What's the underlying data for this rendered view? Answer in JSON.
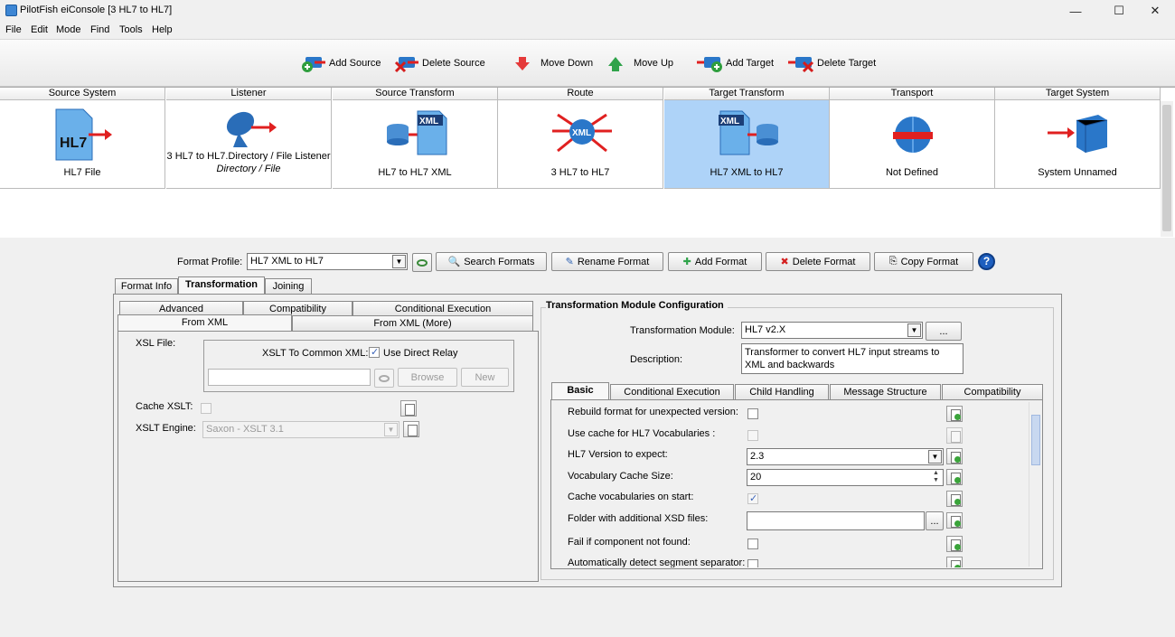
{
  "window": {
    "title": "PilotFish eiConsole [3 HL7 to HL7]"
  },
  "menu": [
    "File",
    "Edit",
    "Mode",
    "Find",
    "Tools",
    "Help"
  ],
  "toolbar": {
    "add_source": "Add Source",
    "delete_source": "Delete Source",
    "move_down": "Move Down",
    "move_up": "Move Up",
    "add_target": "Add Target",
    "delete_target": "Delete Target"
  },
  "pipeline": {
    "headers": [
      "Source System",
      "Listener",
      "Source Transform",
      "Route",
      "Target Transform",
      "Transport",
      "Target System"
    ],
    "labels": [
      "HL7 File",
      "3 HL7 to HL7.Directory / File Listener",
      "HL7 to HL7 XML",
      "3 HL7 to HL7",
      "HL7 XML to HL7",
      "Not Defined",
      "System Unnamed"
    ],
    "listener_sub": "Directory / File",
    "selected": "Target Transform"
  },
  "format": {
    "profile_label": "Format Profile:",
    "profile_value": "HL7 XML to HL7",
    "search": "Search Formats",
    "rename": "Rename Format",
    "add": "Add Format",
    "delete": "Delete Format",
    "copy": "Copy Format"
  },
  "outer_tabs": [
    "Format Info",
    "Transformation",
    "Joining"
  ],
  "inner_tabs_row1": [
    "Advanced",
    "Compatibility",
    "Conditional Execution"
  ],
  "inner_tabs_row2": [
    "From XML",
    "From XML (More)"
  ],
  "from_xml": {
    "xsl_file_label": "XSL File:",
    "xslt_common_label": "XSLT To Common XML:",
    "use_direct_relay": "Use Direct Relay",
    "browse": "Browse",
    "new": "New",
    "cache_xslt_label": "Cache XSLT:",
    "xslt_engine_label": "XSLT Engine:",
    "xslt_engine_value": "Saxon - XSLT 3.1"
  },
  "module_config": {
    "title": "Transformation Module Configuration",
    "module_label": "Transformation Module:",
    "module_value": "HL7 v2.X",
    "ellipsis": "...",
    "description_label": "Description:",
    "description_value": "Transformer to convert HL7 input streams to XML and backwards"
  },
  "config_tabs": [
    "Basic",
    "Conditional Execution",
    "Child Handling",
    "Message Structure",
    "Compatibility"
  ],
  "basic": {
    "rebuild": "Rebuild format for unexpected version:",
    "use_cache": "Use cache for HL7 Vocabularies  :",
    "version_label": "HL7 Version to expect:",
    "version_value": "2.3",
    "cache_size_label": "Vocabulary Cache Size:",
    "cache_size_value": "20",
    "cache_on_start": "Cache vocabularies on start:",
    "folder_label": "Folder with additional XSD files:",
    "fail_label": "Fail if component not found:",
    "auto_detect": "Automatically detect segment separator:"
  }
}
